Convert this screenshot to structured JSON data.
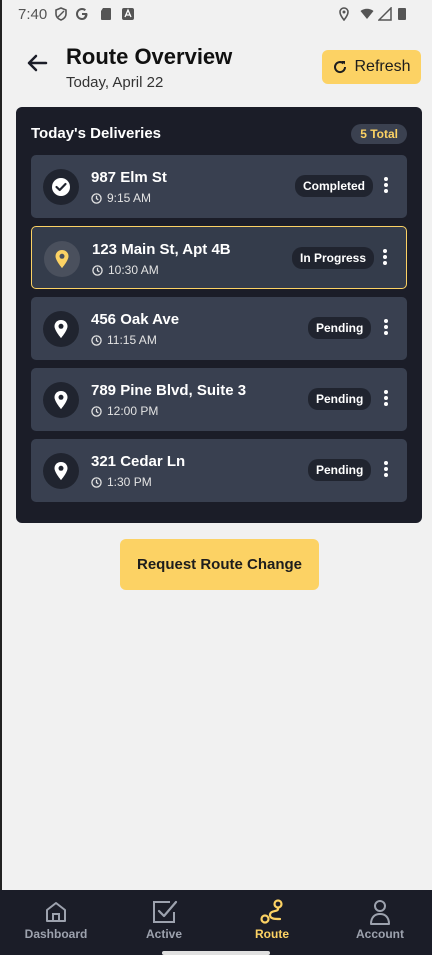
{
  "status_bar": {
    "time": "7:40"
  },
  "header": {
    "title": "Route Overview",
    "subtitle": "Today, April 22",
    "refresh_label": "Refresh"
  },
  "panel": {
    "title": "Today's Deliveries",
    "total": "5 Total",
    "deliveries": [
      {
        "address": "987 Elm St",
        "time": "9:15 AM",
        "status": "Completed"
      },
      {
        "address": "123 Main St, Apt 4B",
        "time": "10:30 AM",
        "status": "In Progress"
      },
      {
        "address": "456 Oak Ave",
        "time": "11:15 AM",
        "status": "Pending"
      },
      {
        "address": "789 Pine Blvd, Suite 3",
        "time": "12:00 PM",
        "status": "Pending"
      },
      {
        "address": "321 Cedar Ln",
        "time": "1:30 PM",
        "status": "Pending"
      }
    ]
  },
  "request_button": "Request Route Change",
  "nav": {
    "items": [
      {
        "label": "Dashboard",
        "icon": "home-icon"
      },
      {
        "label": "Active",
        "icon": "checkbox-icon"
      },
      {
        "label": "Route",
        "icon": "route-icon"
      },
      {
        "label": "Account",
        "icon": "person-icon"
      }
    ],
    "active": "Route"
  },
  "colors": {
    "accent": "#fcd264",
    "panel_bg": "#1b1d28",
    "row_bg": "#394050"
  }
}
